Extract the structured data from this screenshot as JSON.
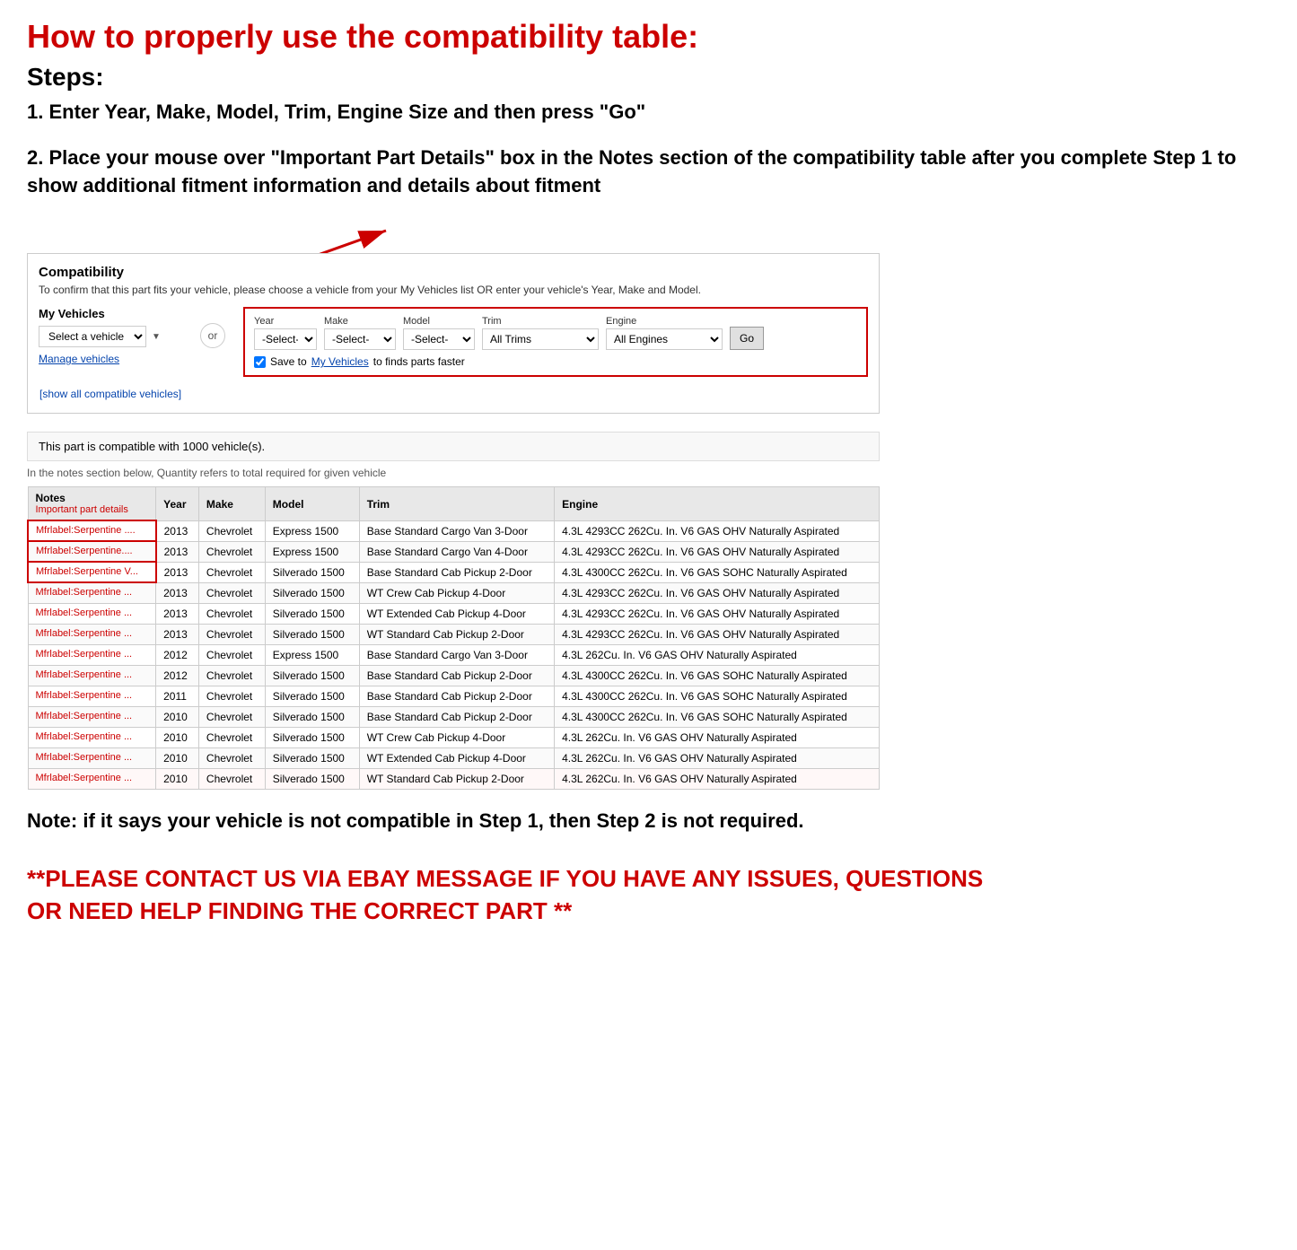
{
  "page": {
    "main_title": "How to properly use the compatibility table:",
    "steps_label": "Steps:",
    "step1": "1. Enter Year, Make, Model, Trim, Engine Size and then press \"Go\"",
    "step2": "2. Place your mouse over \"Important Part Details\" box in the Notes section of the compatibility table after you complete Step 1 to show additional fitment information and details about fitment",
    "note": "Note: if it says your vehicle is not compatible in Step 1, then Step 2 is not required.",
    "contact": "**PLEASE CONTACT US VIA EBAY MESSAGE IF YOU HAVE ANY ISSUES, QUESTIONS OR NEED HELP FINDING THE CORRECT PART **"
  },
  "compatibility": {
    "title": "Compatibility",
    "subtitle": "To confirm that this part fits your vehicle, please choose a vehicle from your My Vehicles list OR enter your vehicle's Year, Make and Model.",
    "my_vehicles_label": "My Vehicles",
    "select_vehicle_placeholder": "Select a vehicle",
    "manage_vehicles": "Manage vehicles",
    "show_all": "[show all compatible vehicles]",
    "or_label": "or",
    "compatible_count": "This part is compatible with 1000 vehicle(s).",
    "quantity_note": "In the notes section below, Quantity refers to total required for given vehicle",
    "year_label": "Year",
    "year_placeholder": "-Select-",
    "make_label": "Make",
    "make_placeholder": "-Select-",
    "model_label": "Model",
    "model_placeholder": "-Select-",
    "trim_label": "Trim",
    "trim_value": "All Trims",
    "engine_label": "Engine",
    "engine_value": "All Engines",
    "go_button": "Go",
    "save_label": "Save to",
    "save_link": "My Vehicles",
    "save_suffix": "to finds parts faster",
    "table_headers": {
      "notes": "Notes",
      "notes_sub": "Important part details",
      "year": "Year",
      "make": "Make",
      "model": "Model",
      "trim": "Trim",
      "engine": "Engine"
    },
    "rows": [
      {
        "notes": "Mfrlabel:Serpentine ....",
        "year": "2013",
        "make": "Chevrolet",
        "model": "Express 1500",
        "trim": "Base Standard Cargo Van 3-Door",
        "engine": "4.3L 4293CC 262Cu. In. V6 GAS OHV Naturally Aspirated",
        "highlight": true
      },
      {
        "notes": "Mfrlabel:Serpentine....",
        "year": "2013",
        "make": "Chevrolet",
        "model": "Express 1500",
        "trim": "Base Standard Cargo Van 4-Door",
        "engine": "4.3L 4293CC 262Cu. In. V6 GAS OHV Naturally Aspirated",
        "highlight": true
      },
      {
        "notes": "Mfrlabel:Serpentine V...",
        "year": "2013",
        "make": "Chevrolet",
        "model": "Silverado 1500",
        "trim": "Base Standard Cab Pickup 2-Door",
        "engine": "4.3L 4300CC 262Cu. In. V6 GAS SOHC Naturally Aspirated",
        "highlight": true
      },
      {
        "notes": "Mfrlabel:Serpentine ...",
        "year": "2013",
        "make": "Chevrolet",
        "model": "Silverado 1500",
        "trim": "WT Crew Cab Pickup 4-Door",
        "engine": "4.3L 4293CC 262Cu. In. V6 GAS OHV Naturally Aspirated",
        "highlight": false
      },
      {
        "notes": "Mfrlabel:Serpentine ...",
        "year": "2013",
        "make": "Chevrolet",
        "model": "Silverado 1500",
        "trim": "WT Extended Cab Pickup 4-Door",
        "engine": "4.3L 4293CC 262Cu. In. V6 GAS OHV Naturally Aspirated",
        "highlight": false
      },
      {
        "notes": "Mfrlabel:Serpentine ...",
        "year": "2013",
        "make": "Chevrolet",
        "model": "Silverado 1500",
        "trim": "WT Standard Cab Pickup 2-Door",
        "engine": "4.3L 4293CC 262Cu. In. V6 GAS OHV Naturally Aspirated",
        "highlight": false
      },
      {
        "notes": "Mfrlabel:Serpentine ...",
        "year": "2012",
        "make": "Chevrolet",
        "model": "Express 1500",
        "trim": "Base Standard Cargo Van 3-Door",
        "engine": "4.3L 262Cu. In. V6 GAS OHV Naturally Aspirated",
        "highlight": false
      },
      {
        "notes": "Mfrlabel:Serpentine ...",
        "year": "2012",
        "make": "Chevrolet",
        "model": "Silverado 1500",
        "trim": "Base Standard Cab Pickup 2-Door",
        "engine": "4.3L 4300CC 262Cu. In. V6 GAS SOHC Naturally Aspirated",
        "highlight": false
      },
      {
        "notes": "Mfrlabel:Serpentine ...",
        "year": "2011",
        "make": "Chevrolet",
        "model": "Silverado 1500",
        "trim": "Base Standard Cab Pickup 2-Door",
        "engine": "4.3L 4300CC 262Cu. In. V6 GAS SOHC Naturally Aspirated",
        "highlight": false
      },
      {
        "notes": "Mfrlabel:Serpentine ...",
        "year": "2010",
        "make": "Chevrolet",
        "model": "Silverado 1500",
        "trim": "Base Standard Cab Pickup 2-Door",
        "engine": "4.3L 4300CC 262Cu. In. V6 GAS SOHC Naturally Aspirated",
        "highlight": false
      },
      {
        "notes": "Mfrlabel:Serpentine ...",
        "year": "2010",
        "make": "Chevrolet",
        "model": "Silverado 1500",
        "trim": "WT Crew Cab Pickup 4-Door",
        "engine": "4.3L 262Cu. In. V6 GAS OHV Naturally Aspirated",
        "highlight": false
      },
      {
        "notes": "Mfrlabel:Serpentine ...",
        "year": "2010",
        "make": "Chevrolet",
        "model": "Silverado 1500",
        "trim": "WT Extended Cab Pickup 4-Door",
        "engine": "4.3L 262Cu. In. V6 GAS OHV Naturally Aspirated",
        "highlight": false
      },
      {
        "notes": "Mfrlabel:Serpentine ...",
        "year": "2010",
        "make": "Chevrolet",
        "model": "Silverado 1500",
        "trim": "WT Standard Cab Pickup 2-Door",
        "engine": "4.3L 262Cu. In. V6 GAS OHV Naturally Aspirated",
        "highlight": false,
        "partial": true
      }
    ]
  }
}
